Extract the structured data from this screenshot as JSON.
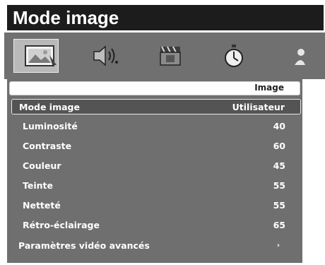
{
  "header": {
    "title": "Mode image"
  },
  "icon_tabs": [
    {
      "name": "picture-icon",
      "selected": true
    },
    {
      "name": "sound-icon",
      "selected": false
    },
    {
      "name": "film-icon",
      "selected": false
    },
    {
      "name": "timer-icon",
      "selected": false
    },
    {
      "name": "user-icon",
      "selected": false
    }
  ],
  "panel": {
    "section_title": "Image",
    "mode": {
      "label": "Mode image",
      "value": "Utilisateur"
    },
    "settings": [
      {
        "label": "Luminosité",
        "value": "40"
      },
      {
        "label": "Contraste",
        "value": "60"
      },
      {
        "label": "Couleur",
        "value": "45"
      },
      {
        "label": "Teinte",
        "value": "55"
      },
      {
        "label": "Netteté",
        "value": "55"
      },
      {
        "label": "Rétro-éclairage",
        "value": "65"
      }
    ],
    "advanced": {
      "label": "Paramètres vidéo avancés",
      "arrow": "›"
    }
  }
}
